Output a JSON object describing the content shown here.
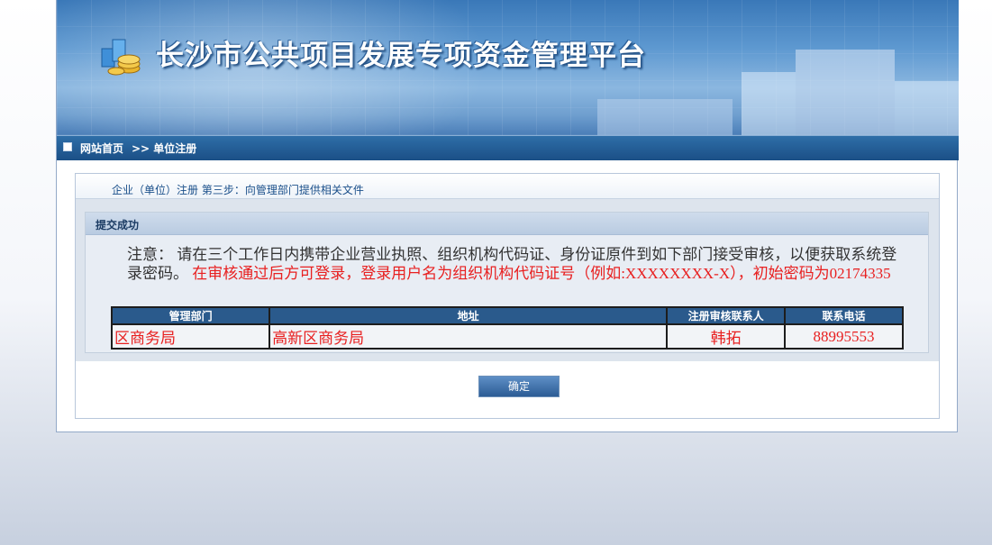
{
  "header": {
    "title": "长沙市公共项目发展专项资金管理平台"
  },
  "nav": {
    "home": "网站首页",
    "breadcrumb": ">> 单位注册"
  },
  "step": {
    "label": "企业（单位）注册 第三步：向管理部门提供相关文件"
  },
  "result": {
    "heading": "提交成功",
    "note_prefix": "注意： 请在三个工作日内携带企业营业执照、组织机构代码证、身份证原件到如下部门接受审核，以便获取系统登录密码。",
    "note_red": "在审核通过后方可登录，登录用户名为组织机构代码证号（例如:XXXXXXXX-X），初始密码为02174335"
  },
  "table": {
    "headers": [
      "管理部门",
      "地址",
      "注册审核联系人",
      "联系电话"
    ],
    "row": {
      "dept": "区商务局",
      "address": "高新区商务局",
      "contact": "韩拓",
      "phone": "88995553"
    }
  },
  "actions": {
    "confirm": "确定"
  },
  "colors": {
    "nav_bar": "#1b4f86",
    "warning_text": "#e82020",
    "table_header": "#2a5a8c"
  }
}
